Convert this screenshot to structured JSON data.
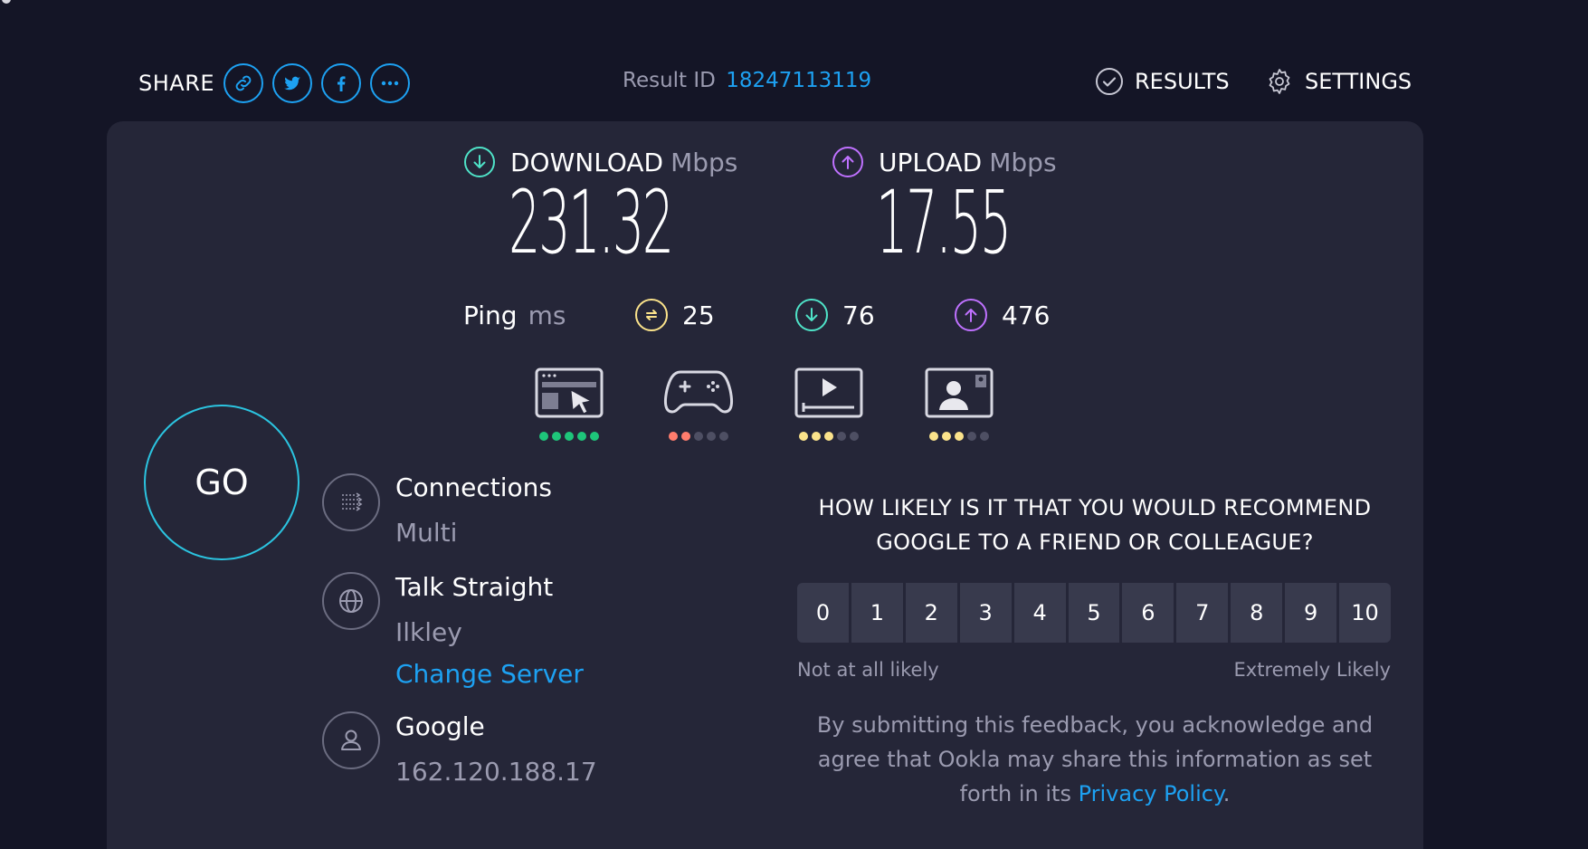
{
  "header": {
    "share_label": "SHARE",
    "share_buttons": [
      "link-icon",
      "twitter-icon",
      "facebook-icon",
      "more-icon"
    ],
    "result_id_label": "Result ID",
    "result_id": "18247113119",
    "results_label": "RESULTS",
    "settings_label": "SETTINGS"
  },
  "download": {
    "label": "DOWNLOAD",
    "unit": "Mbps",
    "value": "231.32",
    "color": "#4fe3c8"
  },
  "upload": {
    "label": "UPLOAD",
    "unit": "Mbps",
    "value": "17.55",
    "color": "#bf71ff"
  },
  "ping": {
    "label": "Ping",
    "unit": "ms",
    "idle": "25",
    "download": "76",
    "upload": "476",
    "idle_color": "#fbe38b"
  },
  "quality": [
    {
      "name": "browsing",
      "dots": [
        "#1ec57a",
        "#1ec57a",
        "#1ec57a",
        "#1ec57a",
        "#1ec57a"
      ]
    },
    {
      "name": "gaming",
      "dots": [
        "#ff7d6d",
        "#ff7d6d",
        "#4e4f63",
        "#4e4f63",
        "#4e4f63"
      ]
    },
    {
      "name": "streaming",
      "dots": [
        "#fbe38b",
        "#fbe38b",
        "#fbe38b",
        "#4e4f63",
        "#4e4f63"
      ]
    },
    {
      "name": "video-chat",
      "dots": [
        "#fbe38b",
        "#fbe38b",
        "#fbe38b",
        "#4e4f63",
        "#4e4f63"
      ]
    }
  ],
  "go_label": "GO",
  "connections": {
    "title": "Connections",
    "value": "Multi"
  },
  "server": {
    "title": "Talk Straight",
    "location": "Ilkley",
    "change_label": "Change Server"
  },
  "provider": {
    "title": "Google",
    "ip": "162.120.188.17"
  },
  "survey": {
    "question_line1": "HOW LIKELY IS IT THAT YOU WOULD RECOMMEND",
    "question_line2": "GOOGLE TO A FRIEND OR COLLEAGUE?",
    "scale": [
      "0",
      "1",
      "2",
      "3",
      "4",
      "5",
      "6",
      "7",
      "8",
      "9",
      "10"
    ],
    "low_label": "Not at all likely",
    "high_label": "Extremely Likely",
    "disclaimer_line1": "By submitting this feedback, you acknowledge and",
    "disclaimer_line2": "agree that Ookla may share this information as set",
    "disclaimer_line3_prefix": "forth in its",
    "privacy_link": "Privacy Policy",
    "disclaimer_suffix": "."
  }
}
